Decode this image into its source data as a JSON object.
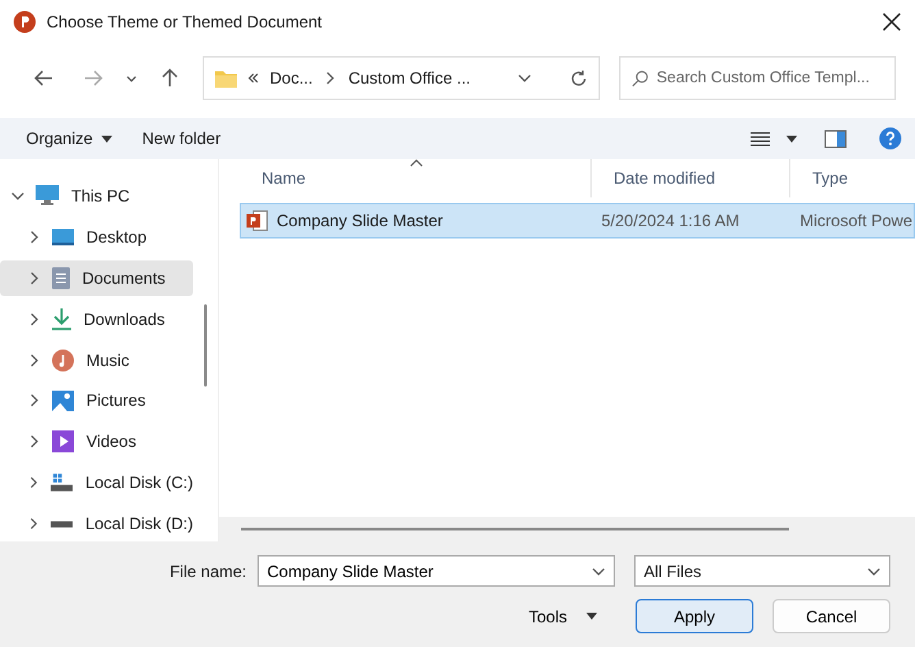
{
  "window": {
    "title": "Choose Theme or Themed Document"
  },
  "address_bar": {
    "segments": [
      "Doc...",
      "Custom Office ..."
    ]
  },
  "search": {
    "placeholder": "Search Custom Office Templ..."
  },
  "toolbar": {
    "organize": "Organize",
    "new_folder": "New folder"
  },
  "sidebar": {
    "items": [
      {
        "label": "This PC",
        "expanded": true,
        "selected": false,
        "children": [
          {
            "label": "Desktop",
            "expanded": false,
            "selected": false
          },
          {
            "label": "Documents",
            "expanded": false,
            "selected": true
          },
          {
            "label": "Downloads",
            "expanded": false,
            "selected": false
          },
          {
            "label": "Music",
            "expanded": false,
            "selected": false
          },
          {
            "label": "Pictures",
            "expanded": false,
            "selected": false
          },
          {
            "label": "Videos",
            "expanded": false,
            "selected": false
          },
          {
            "label": "Local Disk (C:)",
            "expanded": false,
            "selected": false
          },
          {
            "label": "Local Disk (D:)",
            "expanded": false,
            "selected": false
          }
        ]
      }
    ]
  },
  "table": {
    "columns": [
      {
        "label": "Name",
        "sorted": true
      },
      {
        "label": "Date modified",
        "sorted": false
      },
      {
        "label": "Type",
        "sorted": false
      }
    ],
    "rows": [
      {
        "cells": [
          "Company Slide Master",
          "5/20/2024 1:16 AM",
          "Microsoft Powe"
        ],
        "selected": true
      }
    ]
  },
  "footer": {
    "file_name_label": "File name:",
    "file_name": "Company Slide Master",
    "file_type": "All Files",
    "tools": "Tools",
    "buttons": [
      {
        "label": "Apply",
        "default": true
      },
      {
        "label": "Cancel",
        "default": false
      }
    ]
  }
}
